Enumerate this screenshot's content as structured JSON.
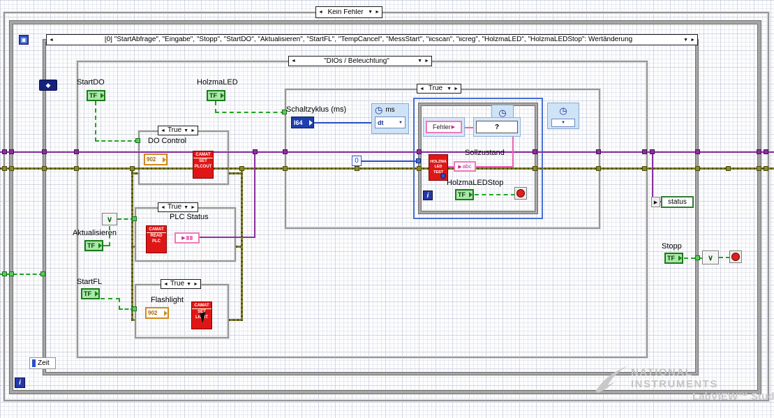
{
  "colors": {
    "boolean_green": "#1fa31f",
    "error_olive": "#7d7d26",
    "string_pink": "#ec5fb4",
    "numeric_blue": "#2a50c8",
    "purple_wire": "#8d2f9e",
    "camat_red": "#e01616"
  },
  "icons": {
    "arrow_left": "◄",
    "arrow_right": "►",
    "dropdown": "▼",
    "clock": "◷",
    "diamond": "◆",
    "timeout": "▣",
    "or": "∨",
    "output_arrow": "▶",
    "question": "?"
  },
  "selectors": {
    "outer_case": "Kein Fehler",
    "event_case": "[0] \"StartAbfrage\", \"Eingabe\", \"Stopp\", \"StartDO\", \"Aktualisieren\", \"StartFL\", \"TempCancel\", \"MessStart\", \"iicscan\", \"iicreg\", \"HolzmaLED\", \"HolzmaLEDStop\": Wertänderung",
    "dios_case": "\"DIOs / Beleuchtung\"",
    "true_case": "True"
  },
  "terminals": {
    "tf": "TF",
    "i64": "I64",
    "startdo_label": "StartDO",
    "holzmaled_label": "HolzmaLED",
    "aktualisieren_label": "Aktualisieren",
    "startfl_label": "StartFL",
    "stopp_label": "Stopp",
    "holzmaledstop_label": "HolzmaLEDStop",
    "schaltzyklus_label": "Schaltzyklus (ms)",
    "status_label": "status",
    "do_control_value": "902",
    "flashlight_value": "902"
  },
  "node_labels": {
    "do_control": "DO Control",
    "plc_status": "PLC Status",
    "flashlight": "Flashlight",
    "sollzustand": "Sollzustand",
    "zeit": "Zeit",
    "iteration": "i",
    "ms": "ms",
    "dt": "dt"
  },
  "camat": {
    "title": "CAMAT",
    "set": "SET",
    "plcout": "PLCOUT",
    "read": "READ",
    "plc": "PLC",
    "light": "LIGHT"
  },
  "holzma_node": {
    "line1": "HOLZMA",
    "line2": "LED",
    "line3": "TEST"
  },
  "constants": {
    "fehler": "Fehler",
    "abc": "abc",
    "zero": "0"
  },
  "watermark": {
    "brand_line1": "NATIONAL",
    "brand_line2": "INSTRUMENTS",
    "edition": "LabVIEW™ Studentenve"
  }
}
